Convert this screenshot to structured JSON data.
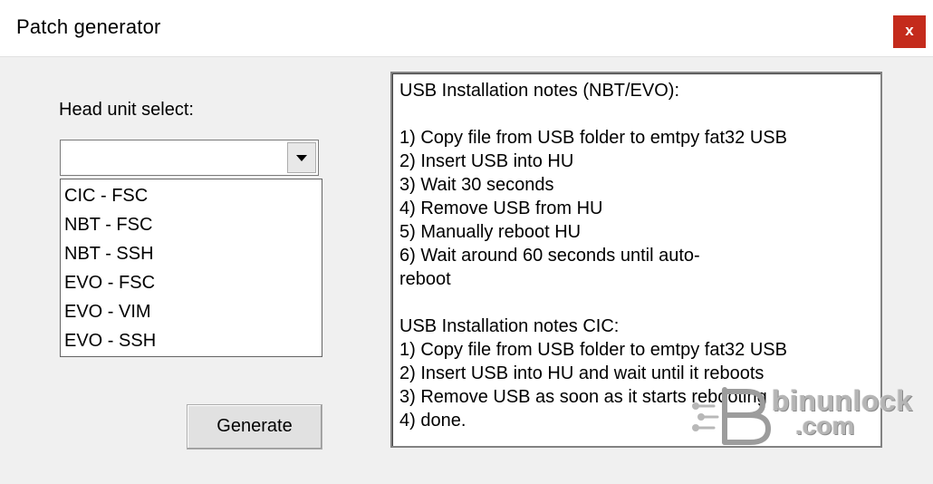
{
  "window": {
    "title": "Patch generator",
    "close_label": "x"
  },
  "head_unit": {
    "label": "Head unit select:",
    "selected_value": "",
    "options": [
      "CIC - FSC",
      "NBT - FSC",
      "NBT - SSH",
      "EVO - FSC",
      "EVO - VIM",
      "EVO - SSH"
    ]
  },
  "generate_button": {
    "label": "Generate"
  },
  "notes": {
    "lines": [
      "USB Installation notes (NBT/EVO):",
      "",
      "1) Copy file from USB folder to emtpy fat32 USB",
      "2) Insert USB into HU",
      "3) Wait 30 seconds",
      "4) Remove USB from HU",
      "5) Manually reboot HU",
      "6) Wait around 60 seconds until auto-",
      "reboot",
      "",
      "USB Installation notes CIC:",
      "1) Copy file from USB folder to emtpy fat32 USB",
      "2) Insert USB into HU and wait until it reboots",
      "3) Remove USB as soon as it starts rebooting",
      "4) done."
    ]
  },
  "watermark": {
    "line1": "binunlock",
    "line2": ".com"
  },
  "colors": {
    "close_bg": "#c42b1c",
    "window_bg": "#f0f0f0",
    "titlebar_bg": "#ffffff"
  }
}
